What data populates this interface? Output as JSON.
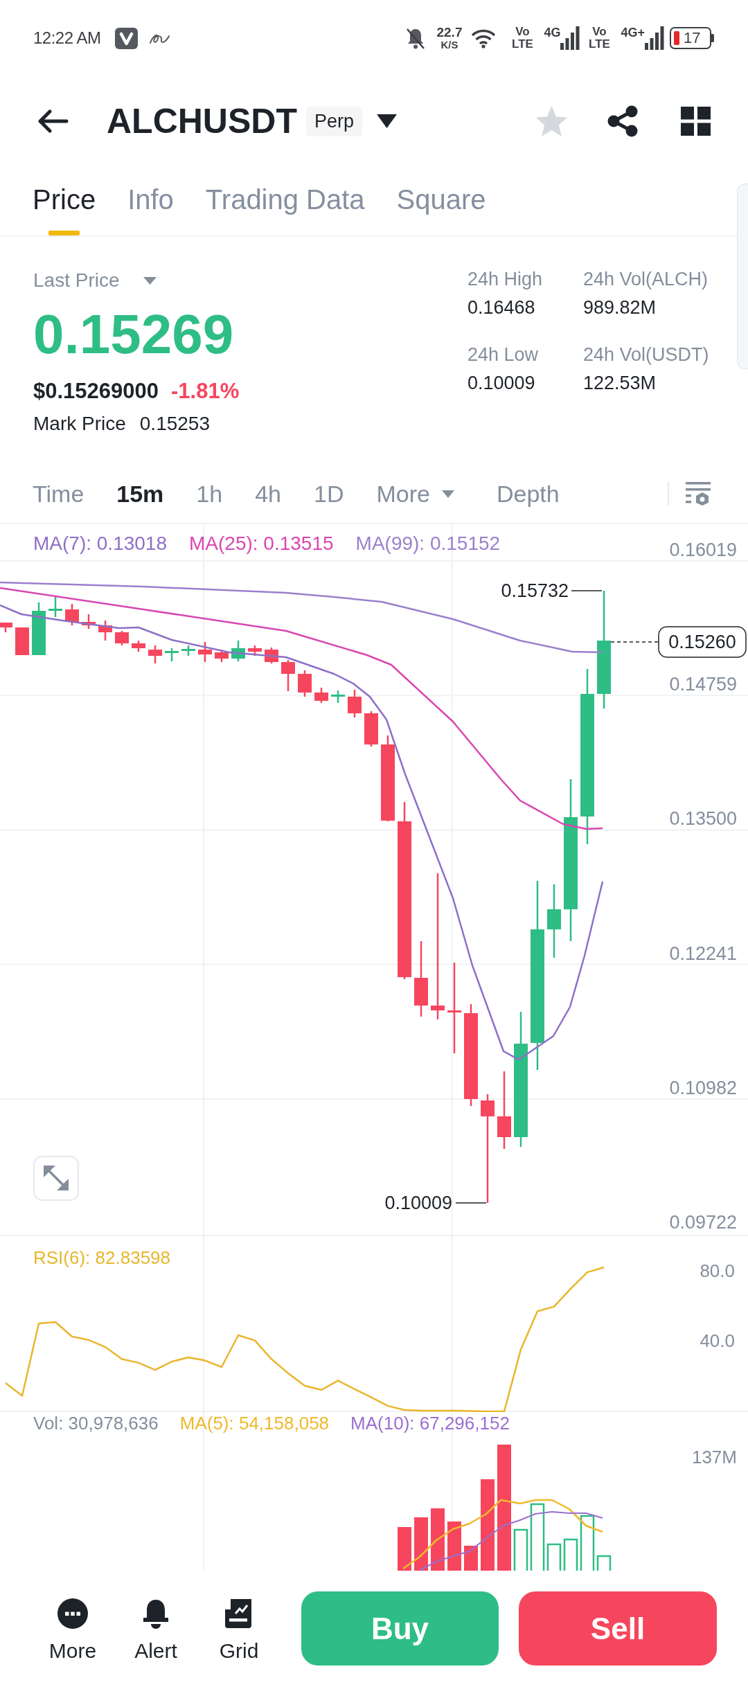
{
  "status_bar": {
    "time": "12:22 AM",
    "speed": "22.7",
    "speed_unit": "K/S",
    "sims": [
      {
        "volte": "Vo LTE",
        "network": "4G"
      },
      {
        "volte": "Vo LTE",
        "network": "4G+"
      }
    ],
    "battery": "17"
  },
  "header": {
    "symbol": "ALCHUSDT",
    "badge": "Perp",
    "favorite": false
  },
  "tabs": [
    {
      "label": "Price",
      "selected": true
    },
    {
      "label": "Info",
      "selected": false
    },
    {
      "label": "Trading Data",
      "selected": false
    },
    {
      "label": "Square",
      "selected": false
    }
  ],
  "price": {
    "label": "Last Price",
    "last": "0.15269",
    "usd": "$0.15269000",
    "change": "-1.81%",
    "mark_label": "Mark Price",
    "mark": "0.15253"
  },
  "stats": [
    {
      "label": "24h High",
      "value": "0.16468"
    },
    {
      "label": "24h Vol(ALCH)",
      "value": "989.82M"
    },
    {
      "label": "24h Low",
      "value": "0.10009"
    },
    {
      "label": "24h Vol(USDT)",
      "value": "122.53M"
    }
  ],
  "intervals": [
    {
      "label": "Time",
      "kind": "interval",
      "selected": false
    },
    {
      "label": "15m",
      "kind": "interval",
      "selected": true
    },
    {
      "label": "1h",
      "kind": "interval",
      "selected": false
    },
    {
      "label": "4h",
      "kind": "interval",
      "selected": false
    },
    {
      "label": "1D",
      "kind": "interval",
      "selected": false
    },
    {
      "label": "More",
      "kind": "dropdown",
      "selected": false
    },
    {
      "label": "Depth",
      "kind": "interval",
      "selected": false
    }
  ],
  "chart": {
    "ma_legend": [
      {
        "text": "MA(7): 0.13018",
        "color": "#8d6fc8"
      },
      {
        "text": "MA(25): 0.13515",
        "color": "#d946b0"
      },
      {
        "text": "MA(99): 0.15152",
        "color": "#9a80cc"
      }
    ],
    "price_axis": [
      "0.16019",
      "0.14759",
      "0.13500",
      "0.12241",
      "0.10982",
      "0.09722"
    ],
    "high": "0.15732",
    "low": "0.10009",
    "current": "0.15260"
  },
  "rsi": {
    "legend": "RSI(6): 82.83598",
    "chart_data": {
      "type": "line",
      "categories": [
        null,
        null,
        null,
        null,
        null,
        null,
        null,
        null,
        null,
        null,
        null,
        null,
        null,
        null,
        null,
        null,
        null,
        null,
        null,
        null,
        null,
        null,
        null,
        null,
        null,
        null,
        null,
        null,
        null,
        null,
        null,
        null,
        null,
        null,
        null,
        null,
        null
      ],
      "ylim": [
        0,
        100
      ],
      "yticks": [
        {
          "value": 80,
          "label": "80.0"
        },
        {
          "value": 40,
          "label": "40.0"
        }
      ],
      "series": [
        {
          "color": "#e8b62c",
          "values": [
            16.1,
            8.9,
            50.0,
            50.8,
            42.5,
            40.6,
            36.6,
            29.7,
            27.6,
            23.6,
            28.3,
            30.7,
            28.9,
            25.2,
            43.3,
            40.3,
            29.7,
            21.7,
            14.6,
            12.2,
            17.5,
            12.6,
            8.0,
            3.1,
            0.8,
            0.4,
            0.4,
            0.4,
            0.2,
            0.0,
            0.0,
            35.2,
            56.9,
            59.6,
            69.7,
            79.1,
            81.9
          ]
        }
      ]
    }
  },
  "volume": {
    "legend": [
      {
        "text": "Vol: 30,978,636",
        "color": "#848e9c"
      },
      {
        "text": "MA(5): 54,158,058",
        "color": "#efb82d"
      },
      {
        "text": "MA(10): 67,296,152",
        "color": "#9a6fd0"
      }
    ],
    "axis_label": "137M"
  },
  "bottom_bar": {
    "actions": [
      {
        "label": "More",
        "kind": "more"
      },
      {
        "label": "Alert",
        "kind": "alert"
      },
      {
        "label": "Grid",
        "kind": "grid"
      }
    ],
    "buy": "Buy",
    "sell": "Sell"
  }
}
